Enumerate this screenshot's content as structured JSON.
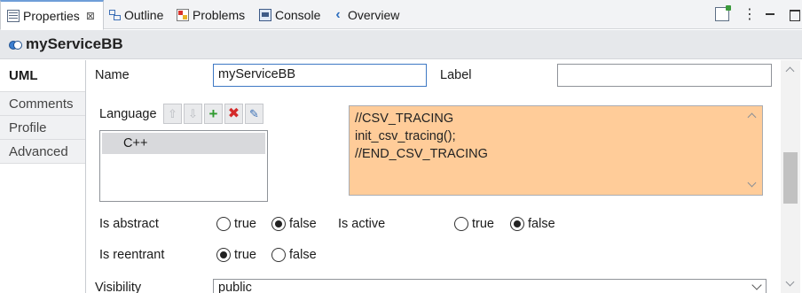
{
  "tabs": [
    {
      "label": "Properties",
      "icon": "properties-icon",
      "active": true,
      "closable": true
    },
    {
      "label": "Outline",
      "icon": "outline-icon"
    },
    {
      "label": "Problems",
      "icon": "problems-icon"
    },
    {
      "label": "Console",
      "icon": "console-icon"
    },
    {
      "label": "Overview",
      "icon": "overview-icon"
    }
  ],
  "toolbar": {
    "icons": [
      "pin-to-view-icon",
      "view-menu-icon",
      "minimize-icon",
      "maximize-icon"
    ],
    "close_glyph": "⊠"
  },
  "header": {
    "title": "myServiceBB",
    "icon": "service-icon"
  },
  "sidebar": {
    "items": [
      {
        "label": "UML",
        "active": true
      },
      {
        "label": "Comments"
      },
      {
        "label": "Profile"
      },
      {
        "label": "Advanced"
      }
    ]
  },
  "form": {
    "name_label": "Name",
    "name_value": "myServiceBB",
    "label_label": "Label",
    "label_value": "",
    "language_label": "Language",
    "language_tools": [
      "move-up-icon",
      "move-down-icon",
      "add-icon",
      "delete-icon",
      "edit-icon"
    ],
    "languages": [
      "C++"
    ],
    "code": [
      "//CSV_TRACING",
      "init_csv_tracing();",
      "//END_CSV_TRACING"
    ],
    "code_bg": "#ffcc99",
    "is_abstract_label": "Is abstract",
    "is_abstract": "false",
    "is_active_label": "Is active",
    "is_active": "false",
    "is_reentrant_label": "Is reentrant",
    "is_reentrant": "true",
    "true_label": "true",
    "false_label": "false",
    "visibility_label": "Visibility",
    "visibility_value": "public"
  },
  "colors": {
    "accent": "#6e9ed8",
    "focus_border": "#3e78c4"
  }
}
